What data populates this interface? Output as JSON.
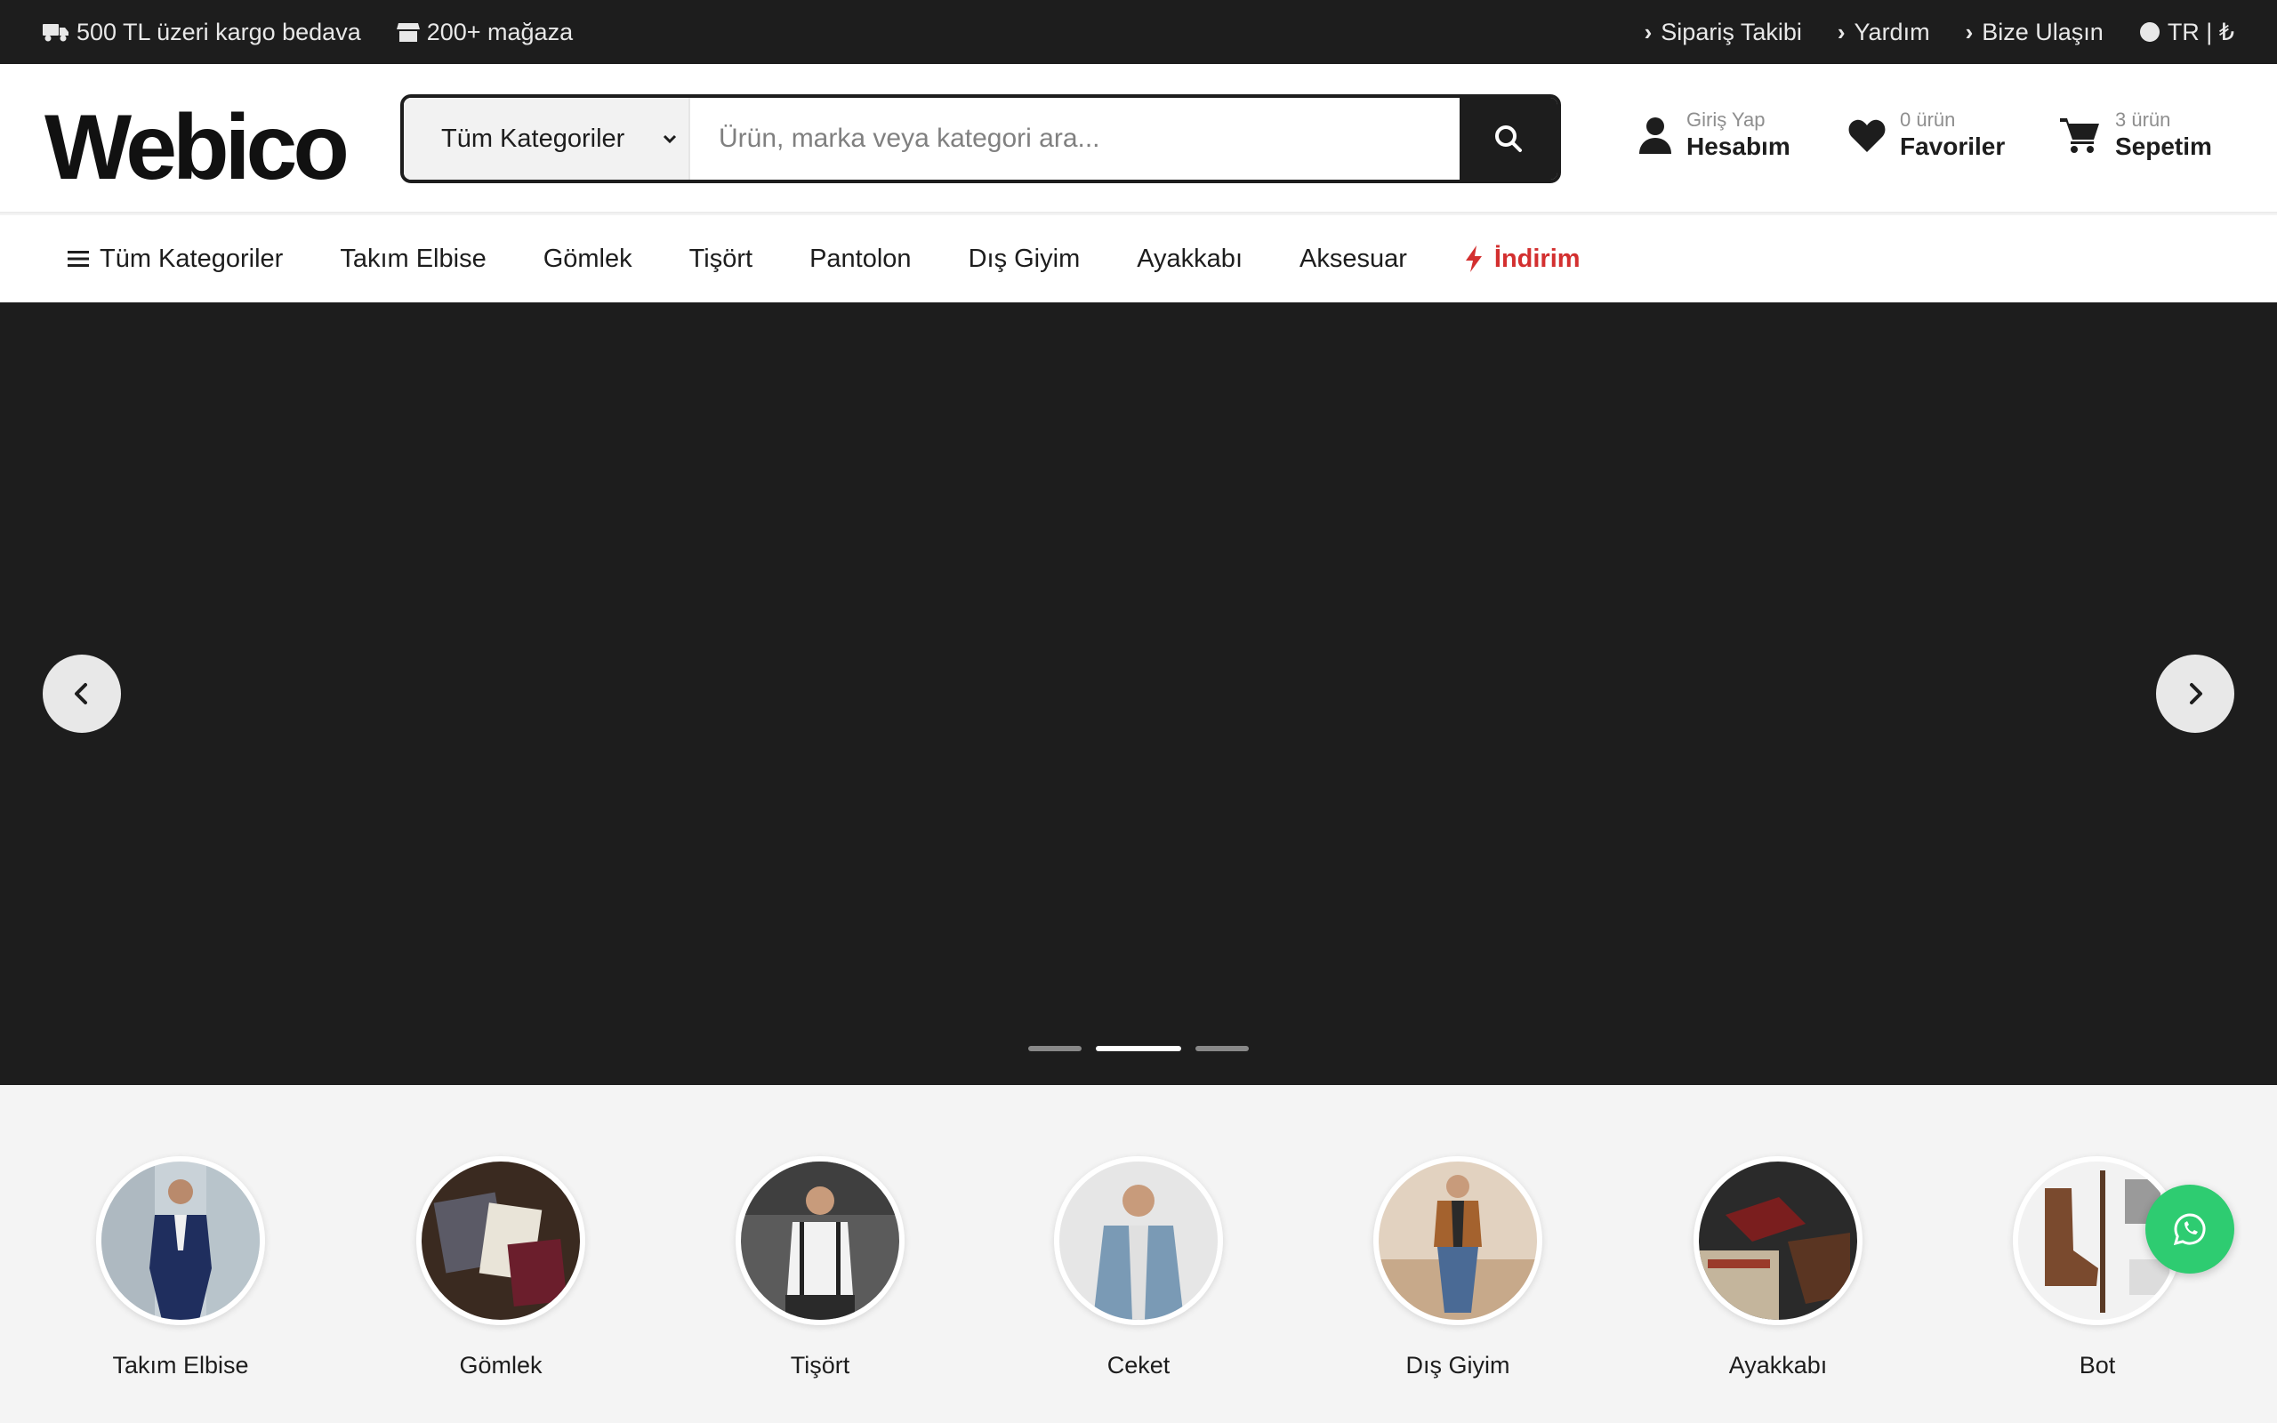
{
  "topbar": {
    "left": [
      {
        "icon": "truck-icon",
        "label": "500 TL üzeri kargo bedava"
      },
      {
        "icon": "store-icon",
        "label": "200+ mağaza"
      }
    ],
    "right": [
      {
        "label": "Sipariş Takibi"
      },
      {
        "label": "Yardım"
      },
      {
        "label": "Bize Ulaşın"
      }
    ],
    "locale": "TR | ₺"
  },
  "header": {
    "logo": "Webico",
    "search": {
      "category": "Tüm Kategoriler",
      "placeholder": "Ürün, marka veya kategori ara..."
    },
    "account": {
      "small": "Giriş Yap",
      "large": "Hesabım"
    },
    "favorites": {
      "small": "0 ürün",
      "large": "Favoriler"
    },
    "cart": {
      "small": "3 ürün",
      "large": "Sepetim"
    }
  },
  "nav": {
    "all": "Tüm Kategoriler",
    "items": [
      "Takım Elbise",
      "Gömlek",
      "Tişört",
      "Pantolon",
      "Dış Giyim",
      "Ayakkabı",
      "Aksesuar"
    ],
    "sale": "İndirim"
  },
  "hero": {
    "slides": 3,
    "active_slide": 2
  },
  "categories": [
    {
      "label": "Takım Elbise",
      "icon": "suit-photo"
    },
    {
      "label": "Gömlek",
      "icon": "shirts-photo"
    },
    {
      "label": "Tişört",
      "icon": "tshirt-photo"
    },
    {
      "label": "Ceket",
      "icon": "jacket-photo"
    },
    {
      "label": "Dış Giyim",
      "icon": "outerwear-photo"
    },
    {
      "label": "Ayakkabı",
      "icon": "shoes-photo"
    },
    {
      "label": "Bot",
      "icon": "boots-photo"
    }
  ],
  "colors": {
    "dark": "#1d1d1d",
    "sale": "#d32f2f",
    "whatsapp": "#2ecc71"
  }
}
